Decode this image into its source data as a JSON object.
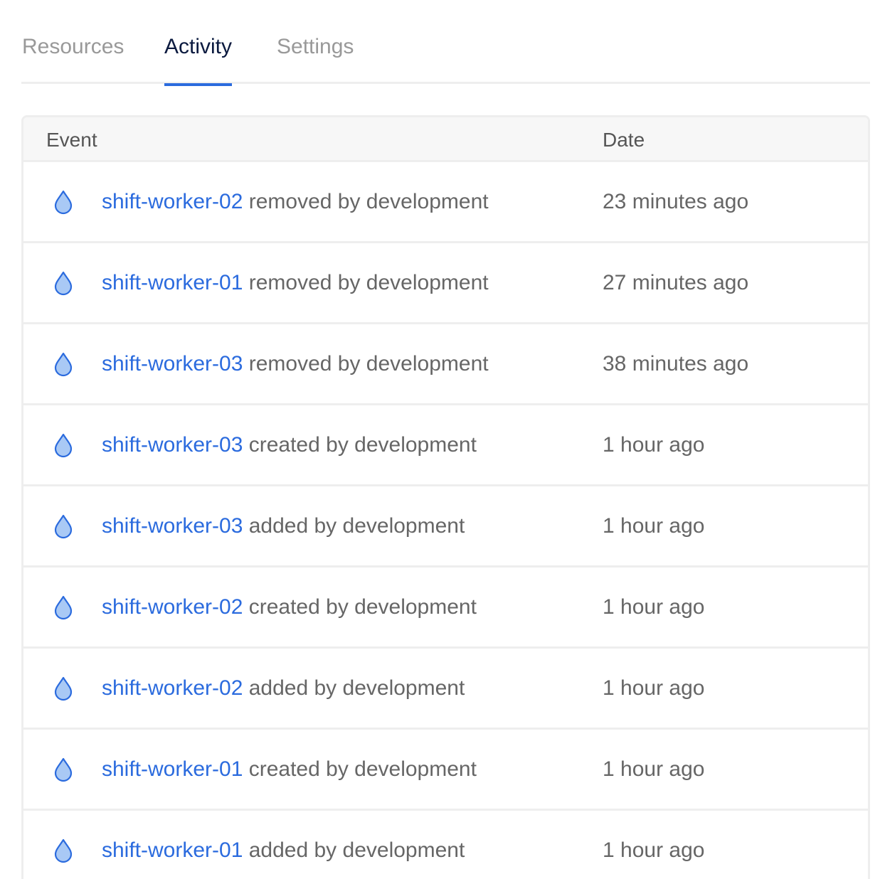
{
  "tabs": [
    {
      "label": "Resources",
      "active": false
    },
    {
      "label": "Activity",
      "active": true
    },
    {
      "label": "Settings",
      "active": false
    }
  ],
  "table": {
    "columns": {
      "event": "Event",
      "date": "Date"
    },
    "rows": [
      {
        "icon": "droplet-icon",
        "resource": "shift-worker-02",
        "action": "removed by development",
        "date": "23 minutes ago"
      },
      {
        "icon": "droplet-icon",
        "resource": "shift-worker-01",
        "action": "removed by development",
        "date": "27 minutes ago"
      },
      {
        "icon": "droplet-icon",
        "resource": "shift-worker-03",
        "action": "removed by development",
        "date": "38 minutes ago"
      },
      {
        "icon": "droplet-icon",
        "resource": "shift-worker-03",
        "action": "created by development",
        "date": "1 hour ago"
      },
      {
        "icon": "droplet-icon",
        "resource": "shift-worker-03",
        "action": "added by development",
        "date": "1 hour ago"
      },
      {
        "icon": "droplet-icon",
        "resource": "shift-worker-02",
        "action": "created by development",
        "date": "1 hour ago"
      },
      {
        "icon": "droplet-icon",
        "resource": "shift-worker-02",
        "action": "added by development",
        "date": "1 hour ago"
      },
      {
        "icon": "droplet-icon",
        "resource": "shift-worker-01",
        "action": "created by development",
        "date": "1 hour ago"
      },
      {
        "icon": "droplet-icon",
        "resource": "shift-worker-01",
        "action": "added by development",
        "date": "1 hour ago"
      }
    ]
  },
  "colors": {
    "accent": "#2b6bde",
    "active_tab_text": "#0b1a3f",
    "inactive_tab_text": "#999999",
    "body_text": "#666666",
    "droplet_fill": "#a9c9f5"
  }
}
